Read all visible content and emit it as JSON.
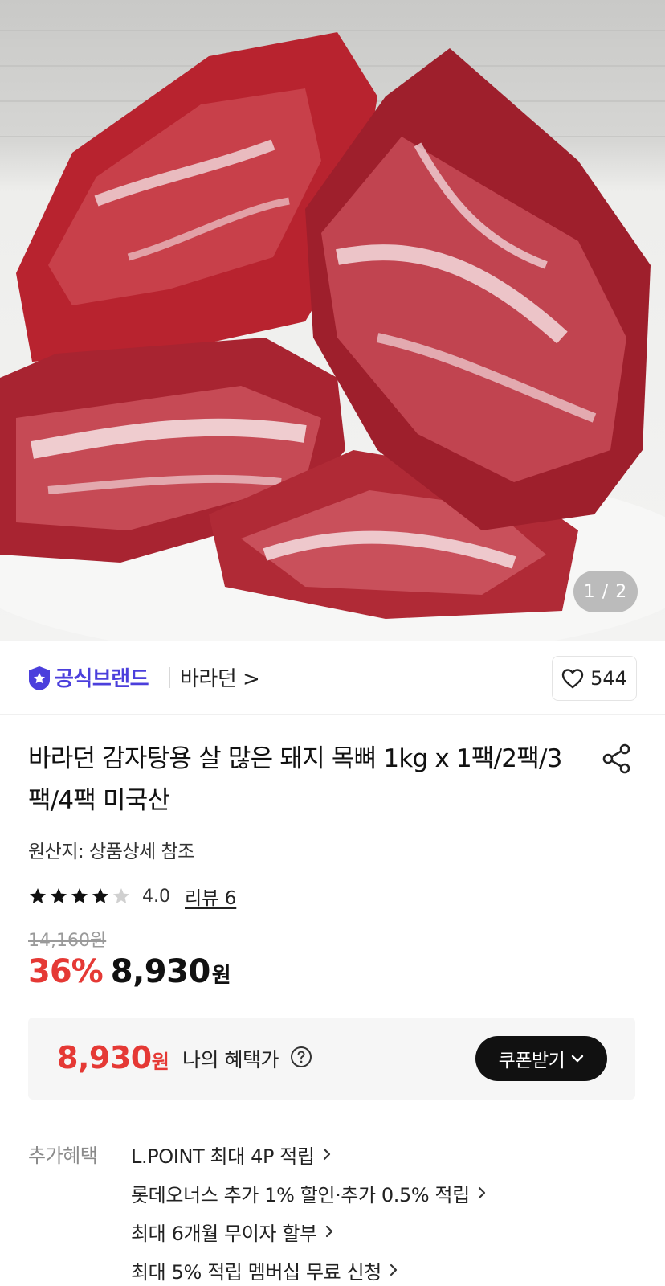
{
  "gallery": {
    "image_desc": "meat-photo",
    "pager": "1 / 2"
  },
  "brand": {
    "badge_label": "공식브랜드",
    "name": "바라던 >",
    "likes": "544"
  },
  "product": {
    "title": "바라던 감자탕용 살 많은 돼지 목뼈 1kg x 1팩/2팩/3팩/4팩 미국산",
    "origin": "원산지: 상품상세 참조",
    "rating_value": "4.0",
    "rating_stars": 4,
    "review_link": "리뷰 6",
    "original_price": "14,160원",
    "discount": "36%",
    "price": "8,930",
    "price_unit": "원"
  },
  "benefit": {
    "price": "8,930",
    "price_unit": "원",
    "label": "나의 혜택가",
    "coupon_button": "쿠폰받기"
  },
  "extra": {
    "label": "추가혜택",
    "items": [
      "L.POINT 최대 4P 적립",
      "롯데오너스 추가 1% 할인·추가 0.5% 적립",
      "최대 6개월 무이자 할부",
      "최대 5% 적립 멤버십 무료 신청"
    ]
  },
  "colors": {
    "brand_accent": "#4b3fdc",
    "discount_red": "#e53935",
    "button_black": "#111111"
  }
}
